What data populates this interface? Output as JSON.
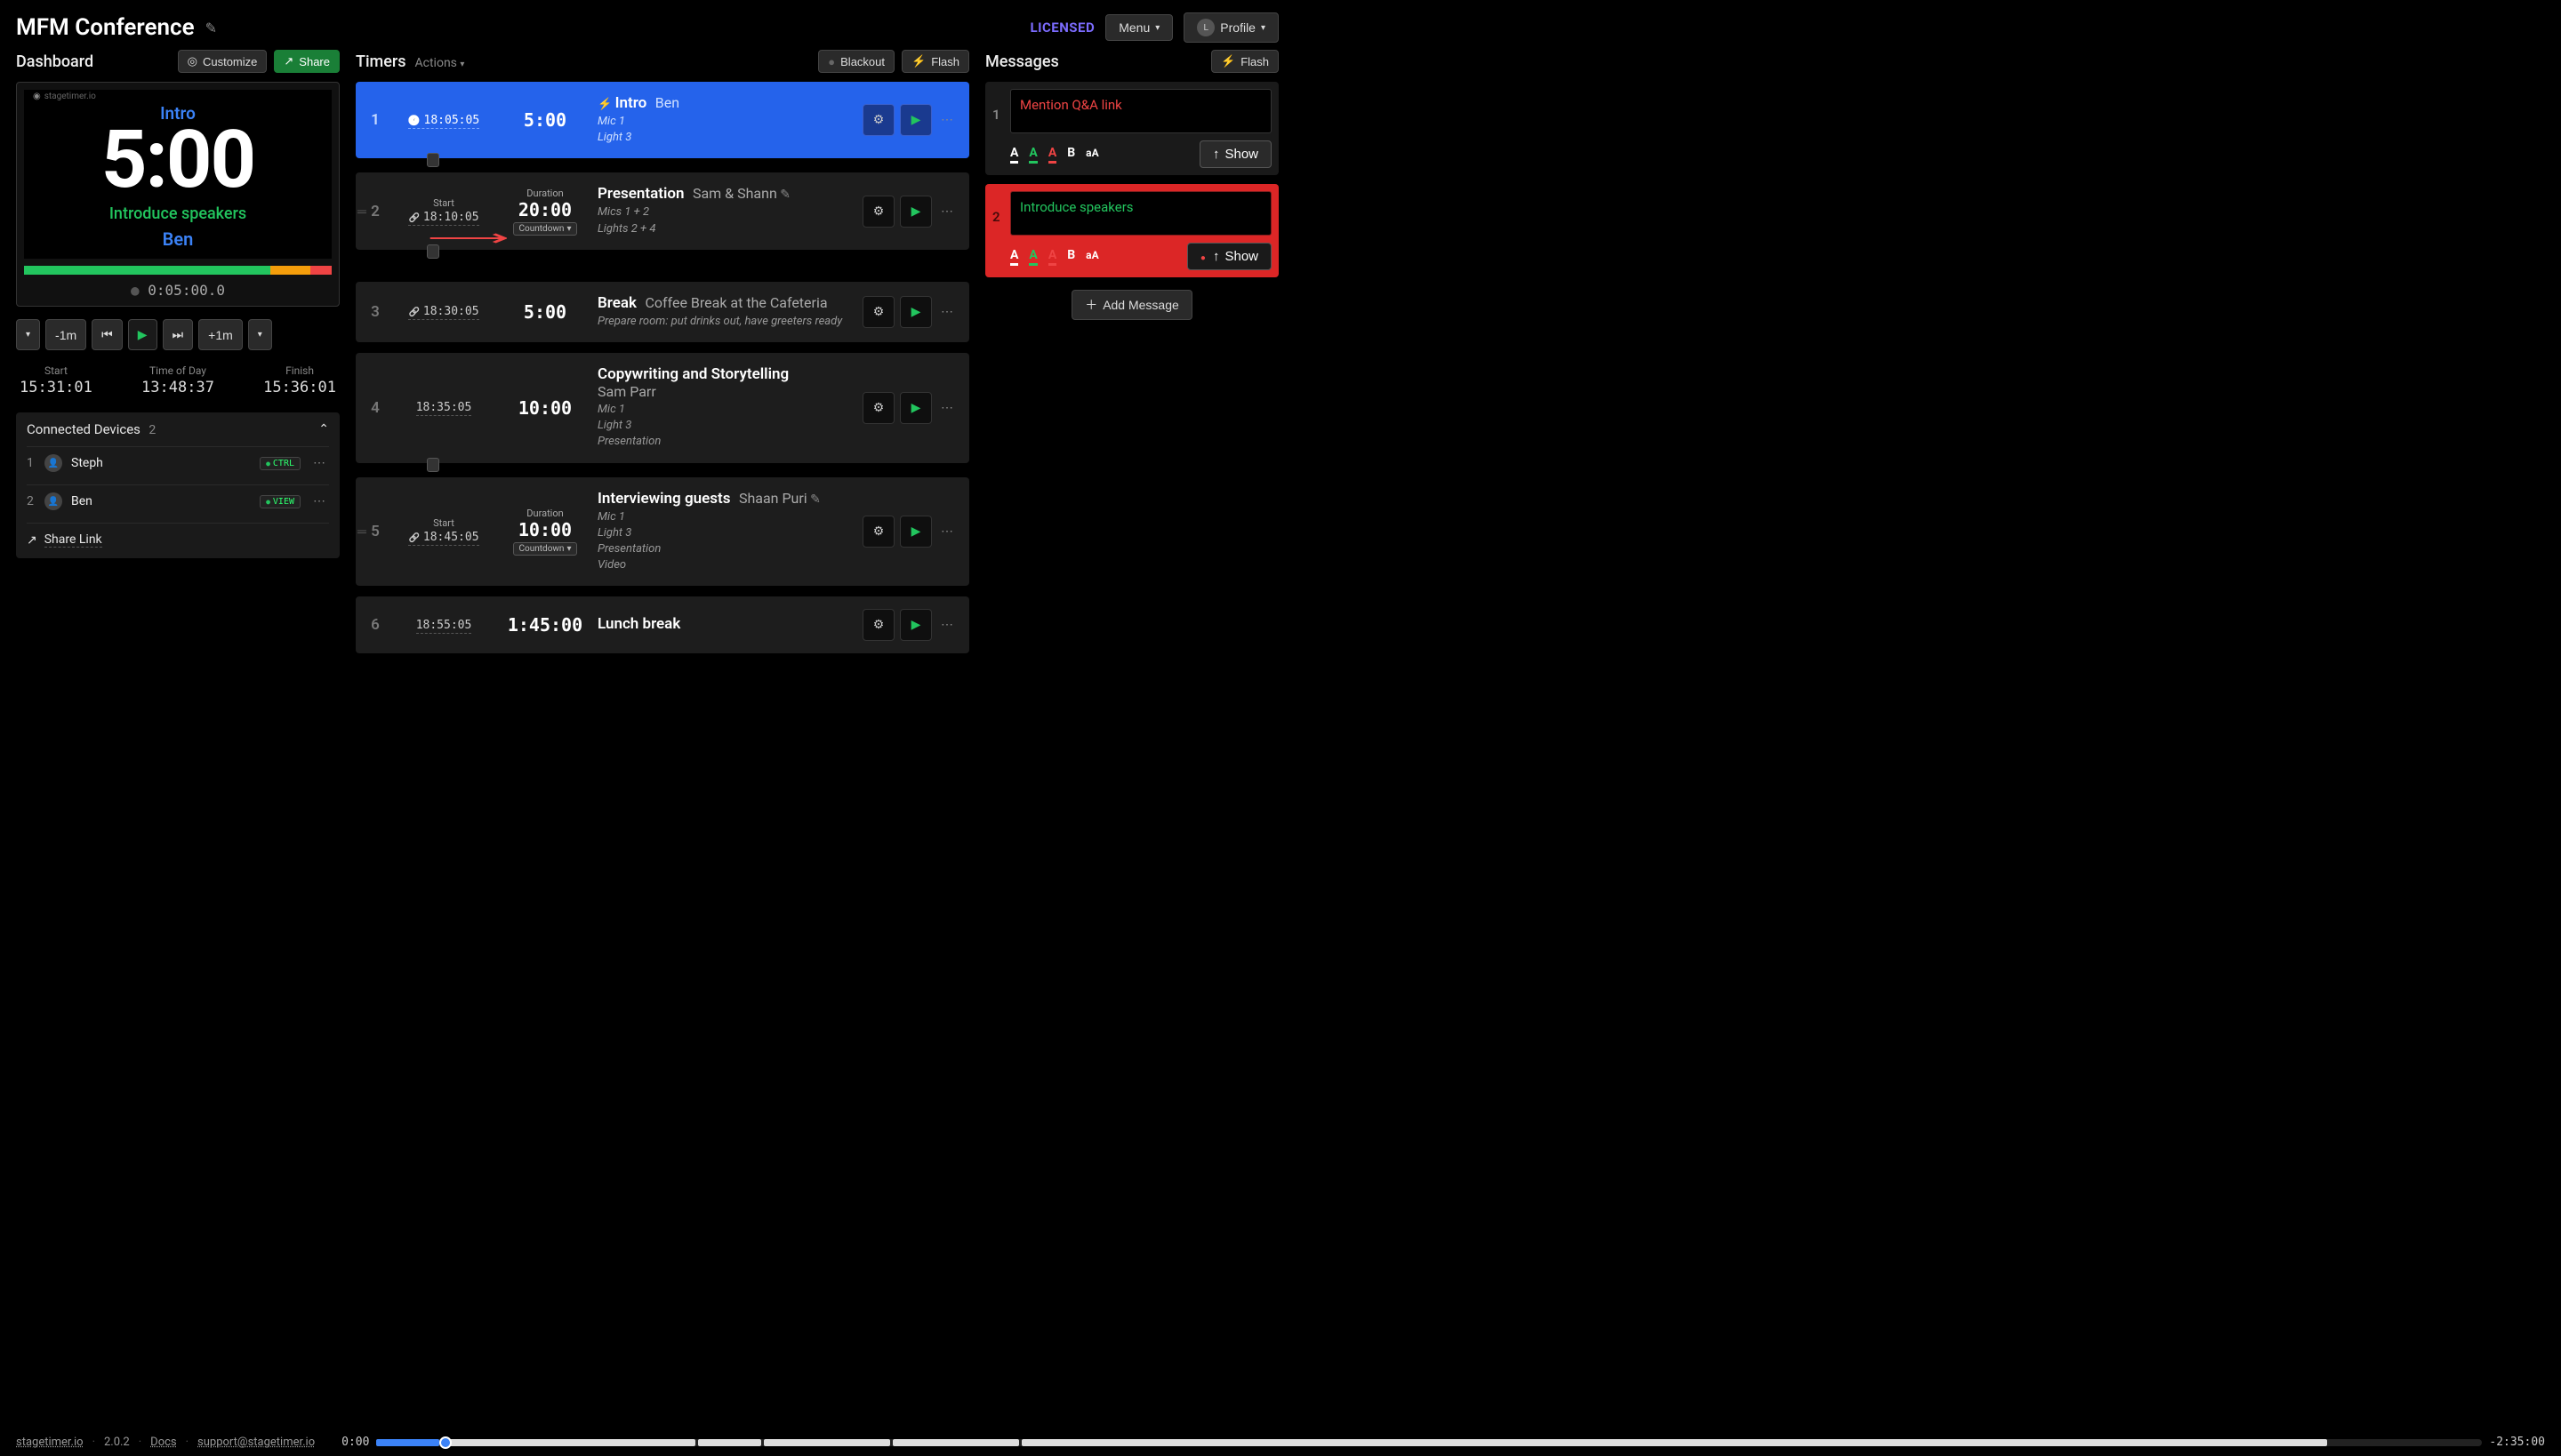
{
  "header": {
    "title": "MFM Conference",
    "licensed": "LICENSED",
    "menu": "Menu",
    "profile": "Profile",
    "profile_initial": "L"
  },
  "dashboard": {
    "title": "Dashboard",
    "customize": "Customize",
    "share": "Share"
  },
  "preview": {
    "logo": "stagetimer.io",
    "intro": "Intro",
    "time": "5:00",
    "message": "Introduce speakers",
    "speaker": "Ben",
    "elapsed": "0:05:00.0"
  },
  "transport": {
    "minus": "-1m",
    "plus": "+1m"
  },
  "times": {
    "start_lbl": "Start",
    "start": "15:31:01",
    "tod_lbl": "Time of Day",
    "tod": "13:48:37",
    "finish_lbl": "Finish",
    "finish": "15:36:01"
  },
  "devices": {
    "title": "Connected Devices",
    "count": "2",
    "list": [
      {
        "idx": "1",
        "name": "Steph",
        "badge": "CTRL"
      },
      {
        "idx": "2",
        "name": "Ben",
        "badge": "VIEW"
      }
    ],
    "share_link": "Share Link"
  },
  "timers": {
    "title": "Timers",
    "actions": "Actions",
    "blackout": "Blackout",
    "flash": "Flash",
    "start_lbl": "Start",
    "duration_lbl": "Duration",
    "countdown": "Countdown",
    "list": [
      {
        "idx": "1",
        "start": "18:05:05",
        "dur": "5:00",
        "title": "Intro",
        "speaker": "Ben",
        "notes": "Mic 1\nLight 3",
        "active": true,
        "bolt": true,
        "clock": true
      },
      {
        "idx": "2",
        "start": "18:10:05",
        "dur": "20:00",
        "title": "Presentation",
        "speaker": "Sam & Shann",
        "notes": "Mics 1 + 2\nLights 2 + 4",
        "show_labels": true,
        "countdown": true,
        "link": true,
        "edit": true,
        "drag": true
      },
      {
        "idx": "3",
        "start": "18:30:05",
        "dur": "5:00",
        "title": "Break",
        "speaker": "Coffee Break at the Cafeteria",
        "notes": "Prepare room: put drinks out, have greeters ready",
        "link": true
      },
      {
        "idx": "4",
        "start": "18:35:05",
        "dur": "10:00",
        "title": "Copywriting and Storytelling",
        "speaker": "Sam Parr",
        "notes": "Mic 1\nLight 3\nPresentation",
        "speaker_block": true
      },
      {
        "idx": "5",
        "start": "18:45:05",
        "dur": "10:00",
        "title": "Interviewing guests",
        "speaker": "Shaan Puri",
        "notes": "Mic 1\nLight 3\nPresentation\nVideo",
        "show_labels": true,
        "countdown": true,
        "link": true,
        "edit": true,
        "drag": true
      },
      {
        "idx": "6",
        "start": "18:55:05",
        "dur": "1:45:00",
        "title": "Lunch break",
        "speaker": "",
        "notes": ""
      }
    ]
  },
  "messages": {
    "title": "Messages",
    "flash": "Flash",
    "show": "Show",
    "add": "Add Message",
    "list": [
      {
        "idx": "1",
        "text": "Mention Q&A link",
        "text_color": "red",
        "variant": "dark"
      },
      {
        "idx": "2",
        "text": "Introduce speakers",
        "text_color": "green",
        "variant": "red"
      }
    ]
  },
  "footer": {
    "site": "stagetimer.io",
    "version": "2.0.2",
    "docs": "Docs",
    "support": "support@stagetimer.io",
    "timeline_start": "0:00",
    "timeline_end": "-2:35:00"
  }
}
